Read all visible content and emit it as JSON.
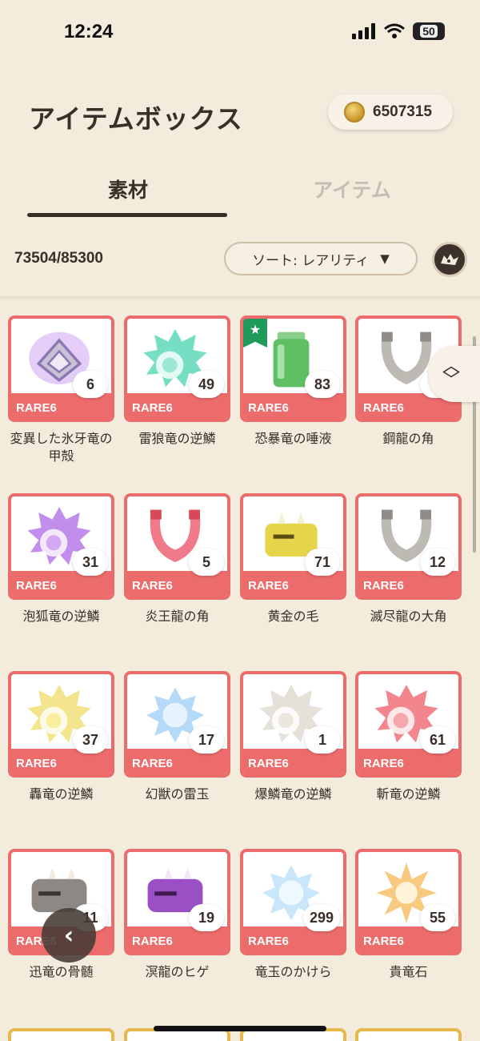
{
  "status": {
    "time": "12:24",
    "battery": "50"
  },
  "header": {
    "title": "アイテムボックス",
    "coins": "6507315"
  },
  "tabs": [
    {
      "label": "素材",
      "active": true
    },
    {
      "label": "アイテム",
      "active": false
    }
  ],
  "toolbar": {
    "capacity": "73504/85300",
    "sort_label": "ソート: レアリティ",
    "sort_arrow": "▼"
  },
  "colors": {
    "background": "#f3ebdc",
    "card_border": "#ec6b6b",
    "text": "#3a2f28",
    "favorite": "#1f9a5a"
  },
  "items": [
    {
      "name": "変異した氷牙竜の甲殻",
      "qty": "6",
      "rarity": "RARE6",
      "icon": "purple-shell-icon"
    },
    {
      "name": "雷狼竜の逆鱗",
      "qty": "49",
      "rarity": "RARE6",
      "icon": "teal-scale-icon"
    },
    {
      "name": "恐暴竜の唾液",
      "qty": "83",
      "rarity": "RARE6",
      "icon": "green-jar-icon",
      "favorite": true
    },
    {
      "name": "鋼龍の角",
      "qty": "4",
      "rarity": "RARE6",
      "icon": "grey-horn-icon"
    },
    {
      "name": "泡狐竜の逆鱗",
      "qty": "31",
      "rarity": "RARE6",
      "icon": "purple-scale-icon"
    },
    {
      "name": "炎王龍の角",
      "qty": "5",
      "rarity": "RARE6",
      "icon": "red-horn-icon"
    },
    {
      "name": "黄金の毛",
      "qty": "71",
      "rarity": "RARE6",
      "icon": "yellow-head-icon"
    },
    {
      "name": "滅尽龍の大角",
      "qty": "12",
      "rarity": "RARE6",
      "icon": "grey-horn-icon"
    },
    {
      "name": "轟竜の逆鱗",
      "qty": "37",
      "rarity": "RARE6",
      "icon": "yellow-scale-icon"
    },
    {
      "name": "幻獣の雷玉",
      "qty": "17",
      "rarity": "RARE6",
      "icon": "blue-orb-icon"
    },
    {
      "name": "爆鱗竜の逆鱗",
      "qty": "1",
      "rarity": "RARE6",
      "icon": "white-scale-icon"
    },
    {
      "name": "斬竜の逆鱗",
      "qty": "61",
      "rarity": "RARE6",
      "icon": "red-scale-icon"
    },
    {
      "name": "迅竜の骨髄",
      "qty": "11",
      "rarity": "RARE6",
      "icon": "grey-head-icon"
    },
    {
      "name": "溟龍のヒゲ",
      "qty": "19",
      "rarity": "RARE6",
      "icon": "purple-head-icon"
    },
    {
      "name": "竜玉のかけら",
      "qty": "299",
      "rarity": "RARE6",
      "icon": "light-blue-orb-icon"
    },
    {
      "name": "貴竜石",
      "qty": "55",
      "rarity": "RARE6",
      "icon": "orange-gem-icon"
    }
  ]
}
